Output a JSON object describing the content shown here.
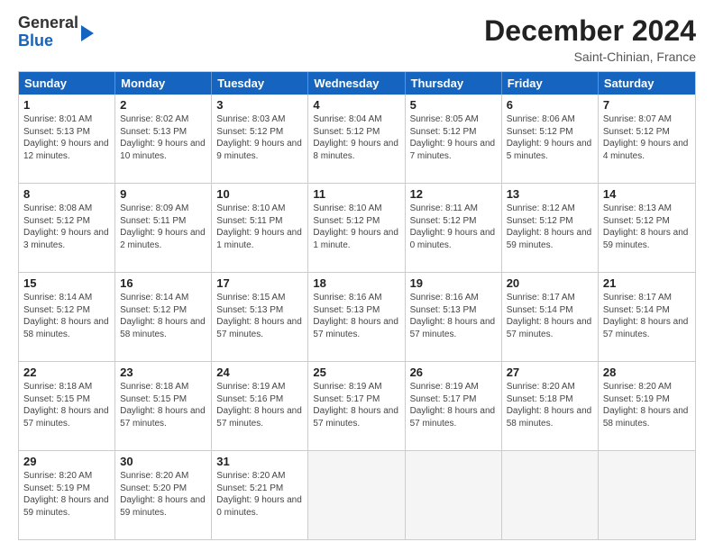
{
  "header": {
    "logo_line1": "General",
    "logo_line2": "Blue",
    "month_title": "December 2024",
    "location": "Saint-Chinian, France"
  },
  "weekdays": [
    "Sunday",
    "Monday",
    "Tuesday",
    "Wednesday",
    "Thursday",
    "Friday",
    "Saturday"
  ],
  "rows": [
    [
      {
        "day": "",
        "sunrise": "",
        "sunset": "",
        "daylight": "",
        "empty": true
      },
      {
        "day": "2",
        "sunrise": "Sunrise: 8:02 AM",
        "sunset": "Sunset: 5:13 PM",
        "daylight": "Daylight: 9 hours and 10 minutes."
      },
      {
        "day": "3",
        "sunrise": "Sunrise: 8:03 AM",
        "sunset": "Sunset: 5:12 PM",
        "daylight": "Daylight: 9 hours and 9 minutes."
      },
      {
        "day": "4",
        "sunrise": "Sunrise: 8:04 AM",
        "sunset": "Sunset: 5:12 PM",
        "daylight": "Daylight: 9 hours and 8 minutes."
      },
      {
        "day": "5",
        "sunrise": "Sunrise: 8:05 AM",
        "sunset": "Sunset: 5:12 PM",
        "daylight": "Daylight: 9 hours and 7 minutes."
      },
      {
        "day": "6",
        "sunrise": "Sunrise: 8:06 AM",
        "sunset": "Sunset: 5:12 PM",
        "daylight": "Daylight: 9 hours and 5 minutes."
      },
      {
        "day": "7",
        "sunrise": "Sunrise: 8:07 AM",
        "sunset": "Sunset: 5:12 PM",
        "daylight": "Daylight: 9 hours and 4 minutes."
      }
    ],
    [
      {
        "day": "8",
        "sunrise": "Sunrise: 8:08 AM",
        "sunset": "Sunset: 5:12 PM",
        "daylight": "Daylight: 9 hours and 3 minutes."
      },
      {
        "day": "9",
        "sunrise": "Sunrise: 8:09 AM",
        "sunset": "Sunset: 5:11 PM",
        "daylight": "Daylight: 9 hours and 2 minutes."
      },
      {
        "day": "10",
        "sunrise": "Sunrise: 8:10 AM",
        "sunset": "Sunset: 5:11 PM",
        "daylight": "Daylight: 9 hours and 1 minute."
      },
      {
        "day": "11",
        "sunrise": "Sunrise: 8:10 AM",
        "sunset": "Sunset: 5:12 PM",
        "daylight": "Daylight: 9 hours and 1 minute."
      },
      {
        "day": "12",
        "sunrise": "Sunrise: 8:11 AM",
        "sunset": "Sunset: 5:12 PM",
        "daylight": "Daylight: 9 hours and 0 minutes."
      },
      {
        "day": "13",
        "sunrise": "Sunrise: 8:12 AM",
        "sunset": "Sunset: 5:12 PM",
        "daylight": "Daylight: 8 hours and 59 minutes."
      },
      {
        "day": "14",
        "sunrise": "Sunrise: 8:13 AM",
        "sunset": "Sunset: 5:12 PM",
        "daylight": "Daylight: 8 hours and 59 minutes."
      }
    ],
    [
      {
        "day": "15",
        "sunrise": "Sunrise: 8:14 AM",
        "sunset": "Sunset: 5:12 PM",
        "daylight": "Daylight: 8 hours and 58 minutes."
      },
      {
        "day": "16",
        "sunrise": "Sunrise: 8:14 AM",
        "sunset": "Sunset: 5:12 PM",
        "daylight": "Daylight: 8 hours and 58 minutes."
      },
      {
        "day": "17",
        "sunrise": "Sunrise: 8:15 AM",
        "sunset": "Sunset: 5:13 PM",
        "daylight": "Daylight: 8 hours and 57 minutes."
      },
      {
        "day": "18",
        "sunrise": "Sunrise: 8:16 AM",
        "sunset": "Sunset: 5:13 PM",
        "daylight": "Daylight: 8 hours and 57 minutes."
      },
      {
        "day": "19",
        "sunrise": "Sunrise: 8:16 AM",
        "sunset": "Sunset: 5:13 PM",
        "daylight": "Daylight: 8 hours and 57 minutes."
      },
      {
        "day": "20",
        "sunrise": "Sunrise: 8:17 AM",
        "sunset": "Sunset: 5:14 PM",
        "daylight": "Daylight: 8 hours and 57 minutes."
      },
      {
        "day": "21",
        "sunrise": "Sunrise: 8:17 AM",
        "sunset": "Sunset: 5:14 PM",
        "daylight": "Daylight: 8 hours and 57 minutes."
      }
    ],
    [
      {
        "day": "22",
        "sunrise": "Sunrise: 8:18 AM",
        "sunset": "Sunset: 5:15 PM",
        "daylight": "Daylight: 8 hours and 57 minutes."
      },
      {
        "day": "23",
        "sunrise": "Sunrise: 8:18 AM",
        "sunset": "Sunset: 5:15 PM",
        "daylight": "Daylight: 8 hours and 57 minutes."
      },
      {
        "day": "24",
        "sunrise": "Sunrise: 8:19 AM",
        "sunset": "Sunset: 5:16 PM",
        "daylight": "Daylight: 8 hours and 57 minutes."
      },
      {
        "day": "25",
        "sunrise": "Sunrise: 8:19 AM",
        "sunset": "Sunset: 5:17 PM",
        "daylight": "Daylight: 8 hours and 57 minutes."
      },
      {
        "day": "26",
        "sunrise": "Sunrise: 8:19 AM",
        "sunset": "Sunset: 5:17 PM",
        "daylight": "Daylight: 8 hours and 57 minutes."
      },
      {
        "day": "27",
        "sunrise": "Sunrise: 8:20 AM",
        "sunset": "Sunset: 5:18 PM",
        "daylight": "Daylight: 8 hours and 58 minutes."
      },
      {
        "day": "28",
        "sunrise": "Sunrise: 8:20 AM",
        "sunset": "Sunset: 5:19 PM",
        "daylight": "Daylight: 8 hours and 58 minutes."
      }
    ],
    [
      {
        "day": "29",
        "sunrise": "Sunrise: 8:20 AM",
        "sunset": "Sunset: 5:19 PM",
        "daylight": "Daylight: 8 hours and 59 minutes."
      },
      {
        "day": "30",
        "sunrise": "Sunrise: 8:20 AM",
        "sunset": "Sunset: 5:20 PM",
        "daylight": "Daylight: 8 hours and 59 minutes."
      },
      {
        "day": "31",
        "sunrise": "Sunrise: 8:20 AM",
        "sunset": "Sunset: 5:21 PM",
        "daylight": "Daylight: 9 hours and 0 minutes."
      },
      {
        "day": "",
        "sunrise": "",
        "sunset": "",
        "daylight": "",
        "empty": true
      },
      {
        "day": "",
        "sunrise": "",
        "sunset": "",
        "daylight": "",
        "empty": true
      },
      {
        "day": "",
        "sunrise": "",
        "sunset": "",
        "daylight": "",
        "empty": true
      },
      {
        "day": "",
        "sunrise": "",
        "sunset": "",
        "daylight": "",
        "empty": true
      }
    ]
  ],
  "row0_day1": {
    "day": "1",
    "sunrise": "Sunrise: 8:01 AM",
    "sunset": "Sunset: 5:13 PM",
    "daylight": "Daylight: 9 hours and 12 minutes."
  }
}
